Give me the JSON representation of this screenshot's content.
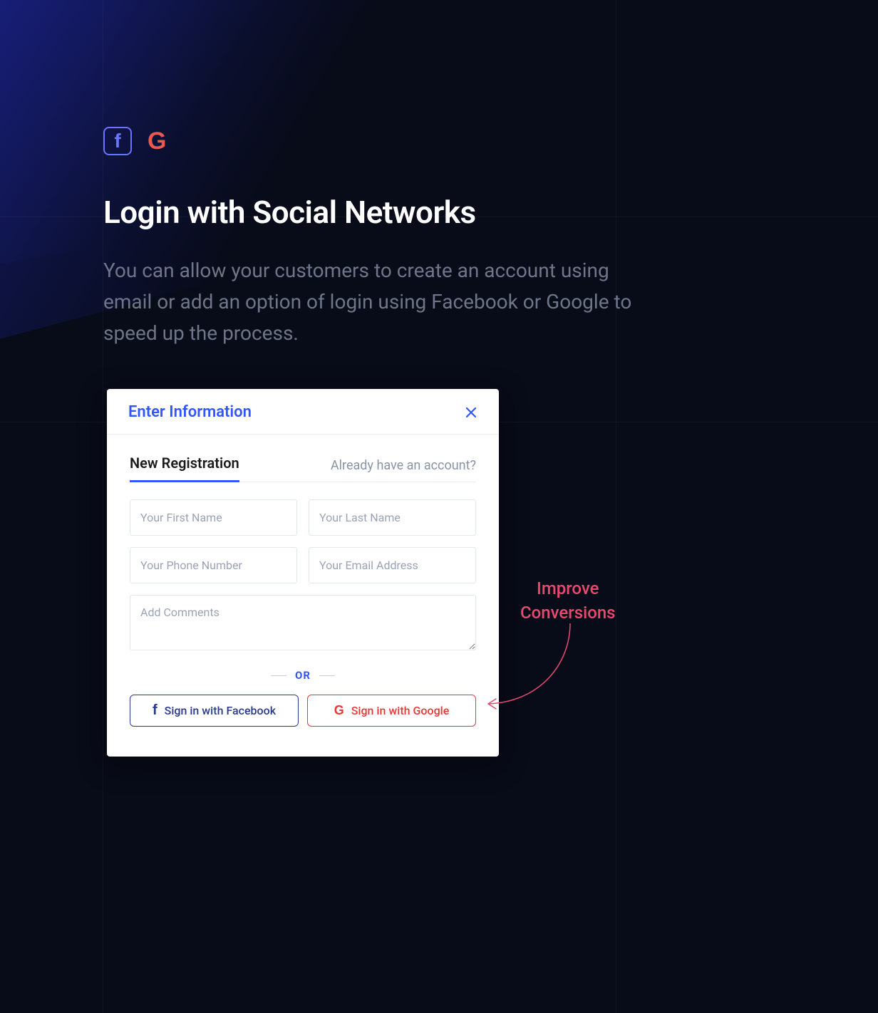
{
  "hero": {
    "title": "Login with Social Networks",
    "description": "You can allow your customers to create an account using email or add an option of login using Facebook or Google to speed up the process."
  },
  "modal": {
    "title": "Enter Information",
    "tabs": {
      "active": "New Registration",
      "link": "Already have an account?"
    },
    "placeholders": {
      "first_name": "Your First Name",
      "last_name": "Your Last Name",
      "phone": "Your Phone Number",
      "email": "Your Email Address",
      "comments": "Add Comments"
    },
    "divider": "OR",
    "buttons": {
      "facebook": "Sign in with Facebook",
      "google": "Sign in with Google"
    }
  },
  "callout": {
    "line1": "Improve",
    "line2": "Conversions"
  }
}
